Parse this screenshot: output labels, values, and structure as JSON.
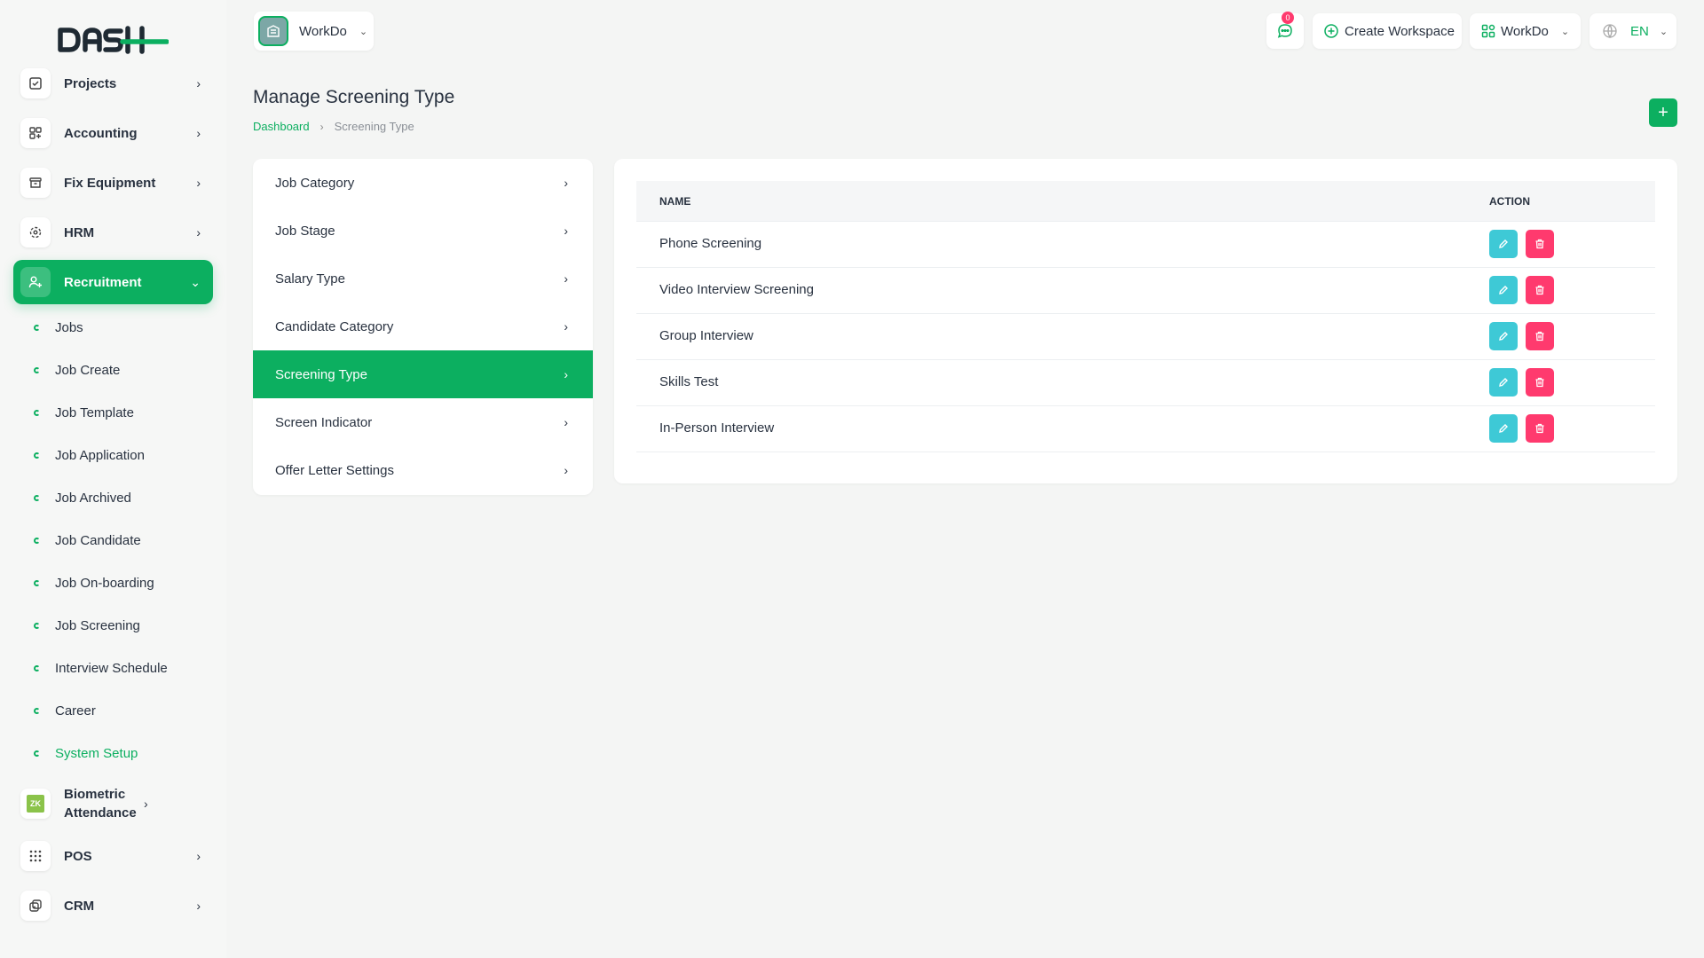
{
  "brand": {
    "logo_text": "DASH",
    "accent": "#0caf60",
    "danger": "#ff3a6e",
    "info": "#3ec9d6"
  },
  "sidebar": {
    "items": [
      {
        "label": "Projects",
        "icon": "checkbox-icon"
      },
      {
        "label": "Accounting",
        "icon": "grid-icon"
      },
      {
        "label": "Fix Equipment",
        "icon": "archive-icon"
      },
      {
        "label": "HRM",
        "icon": "hrm-icon"
      },
      {
        "label": "Recruitment",
        "icon": "user-plus-icon",
        "active": true
      },
      {
        "label": "Biometric Attendance",
        "icon": "zk-icon"
      },
      {
        "label": "POS",
        "icon": "dots-grid-icon"
      },
      {
        "label": "CRM",
        "icon": "crm-icon"
      }
    ],
    "recruitment_sub": [
      "Jobs",
      "Job Create",
      "Job Template",
      "Job Application",
      "Job Archived",
      "Job Candidate",
      "Job On-boarding",
      "Job Screening",
      "Interview Schedule",
      "Career",
      "System Setup"
    ],
    "current_sub": "System Setup"
  },
  "header": {
    "workspace": "WorkDo",
    "notification_count": "0",
    "create_workspace": "Create Workspace",
    "workspace_menu": "WorkDo",
    "language": "EN"
  },
  "page": {
    "title": "Manage Screening Type",
    "breadcrumb": [
      "Dashboard",
      "Screening Type"
    ]
  },
  "settings_menu": [
    "Job Category",
    "Job Stage",
    "Salary Type",
    "Candidate Category",
    "Screening Type",
    "Screen Indicator",
    "Offer Letter Settings"
  ],
  "active_setting": "Screening Type",
  "table": {
    "columns": [
      "NAME",
      "ACTION"
    ],
    "rows": [
      "Phone Screening",
      "Video Interview Screening",
      "Group Interview",
      "Skills Test",
      "In-Person Interview"
    ]
  }
}
